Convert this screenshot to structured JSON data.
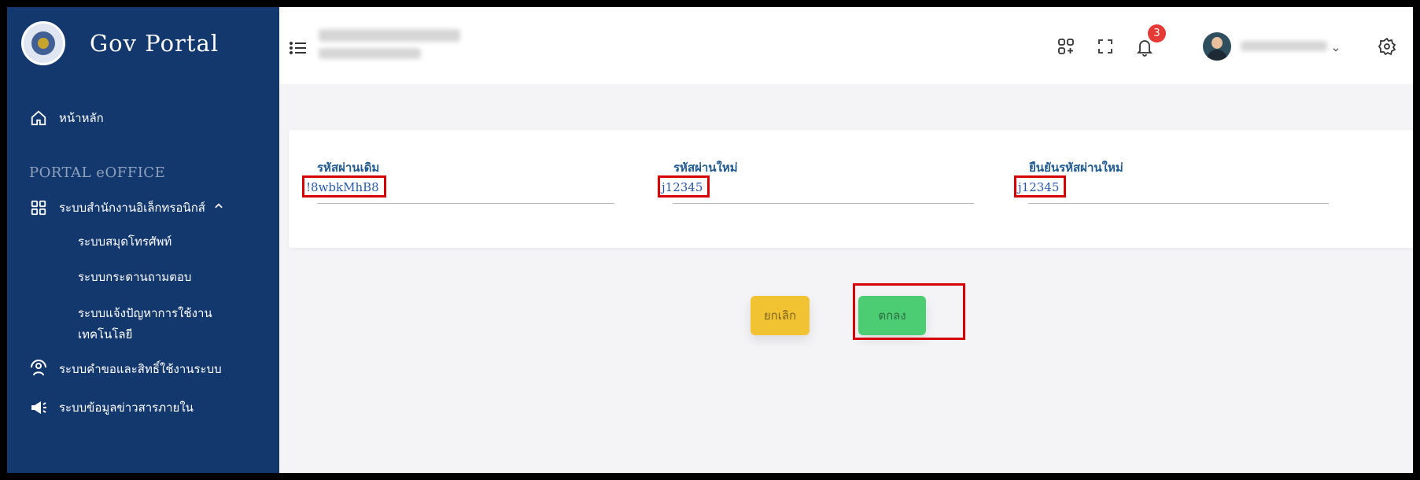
{
  "app": {
    "title": "Gov Portal"
  },
  "sidebar": {
    "home_label": "หน้าหลัก",
    "section_label": "PORTAL eOFFICE",
    "group_label": "ระบบสำนักงานอิเล็กทรอนิกส์",
    "group_expanded_icon": "chevron-up-icon",
    "sub_items": [
      {
        "label": "ระบบสมุดโทรศัพท์"
      },
      {
        "label": "ระบบกระดานถามตอบ"
      },
      {
        "label": "ระบบแจ้งปัญหาการใช้งาน เทคโนโลยี"
      }
    ],
    "items": [
      {
        "label": "ระบบคำขอและสิทธิ์ใช้งานระบบ",
        "icon": "support-icon"
      },
      {
        "label": "ระบบข้อมูลข่าวสารภายใน",
        "icon": "megaphone-icon"
      }
    ]
  },
  "header": {
    "menu_icon": "list-icon",
    "icons": [
      "apps-add-icon",
      "fullscreen-icon",
      "bell-icon",
      "settings-icon"
    ],
    "notification_count": "3"
  },
  "form": {
    "fields": [
      {
        "label": "รหัสผ่านเดิม",
        "value": "!8wbkMhB8"
      },
      {
        "label": "รหัสผ่านใหม่",
        "value": "j12345"
      },
      {
        "label": "ยืนยันรหัสผ่านใหม่",
        "value": "j12345"
      }
    ],
    "cancel_label": "ยกเลิก",
    "ok_label": "ตกลง"
  },
  "colors": {
    "sidebar_bg": "#13386d",
    "highlight": "#d60000",
    "cancel_bg": "#f1c232",
    "ok_bg": "#4ccd74",
    "label_color": "#205a8e"
  }
}
